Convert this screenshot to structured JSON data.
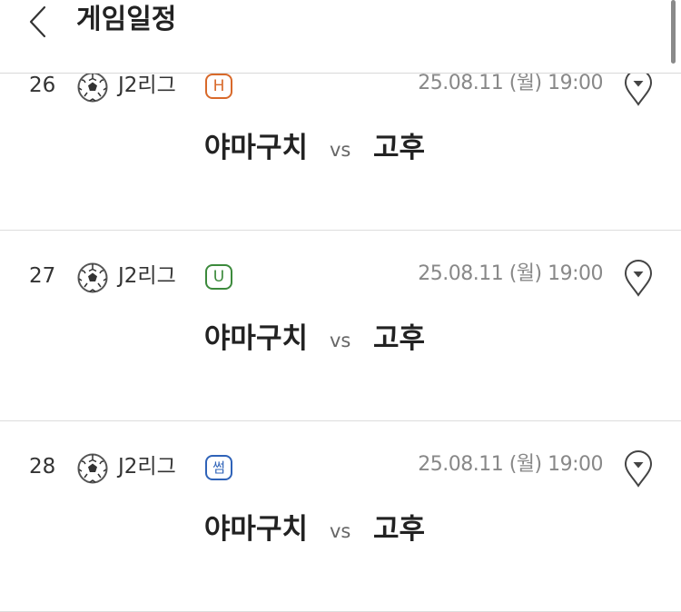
{
  "header": {
    "title": "게임일정",
    "back_icon": "chevron-left-icon"
  },
  "colors": {
    "badge_h": "#d8692a",
    "badge_u": "#3c8a3c",
    "badge_o": "#2f63b8",
    "divider": "#dddddd",
    "datetime": "#888888"
  },
  "games": [
    {
      "round": "26",
      "sport_icon": "soccer-ball-icon",
      "league": "J2리그",
      "badge": "H",
      "badge_color": "#d8692a",
      "datetime": "25.08.11 (월) 19:00",
      "venue_icon": "location-pin-icon",
      "home_team": "야마구치",
      "vs": "vs",
      "away_team": "고후"
    },
    {
      "round": "27",
      "sport_icon": "soccer-ball-icon",
      "league": "J2리그",
      "badge": "U",
      "badge_color": "#3c8a3c",
      "datetime": "25.08.11 (월) 19:00",
      "venue_icon": "location-pin-icon",
      "home_team": "야마구치",
      "vs": "vs",
      "away_team": "고후"
    },
    {
      "round": "28",
      "sport_icon": "soccer-ball-icon",
      "league": "J2리그",
      "badge": "썸",
      "badge_color": "#2f63b8",
      "datetime": "25.08.11 (월) 19:00",
      "venue_icon": "location-pin-icon",
      "home_team": "야마구치",
      "vs": "vs",
      "away_team": "고후"
    }
  ]
}
